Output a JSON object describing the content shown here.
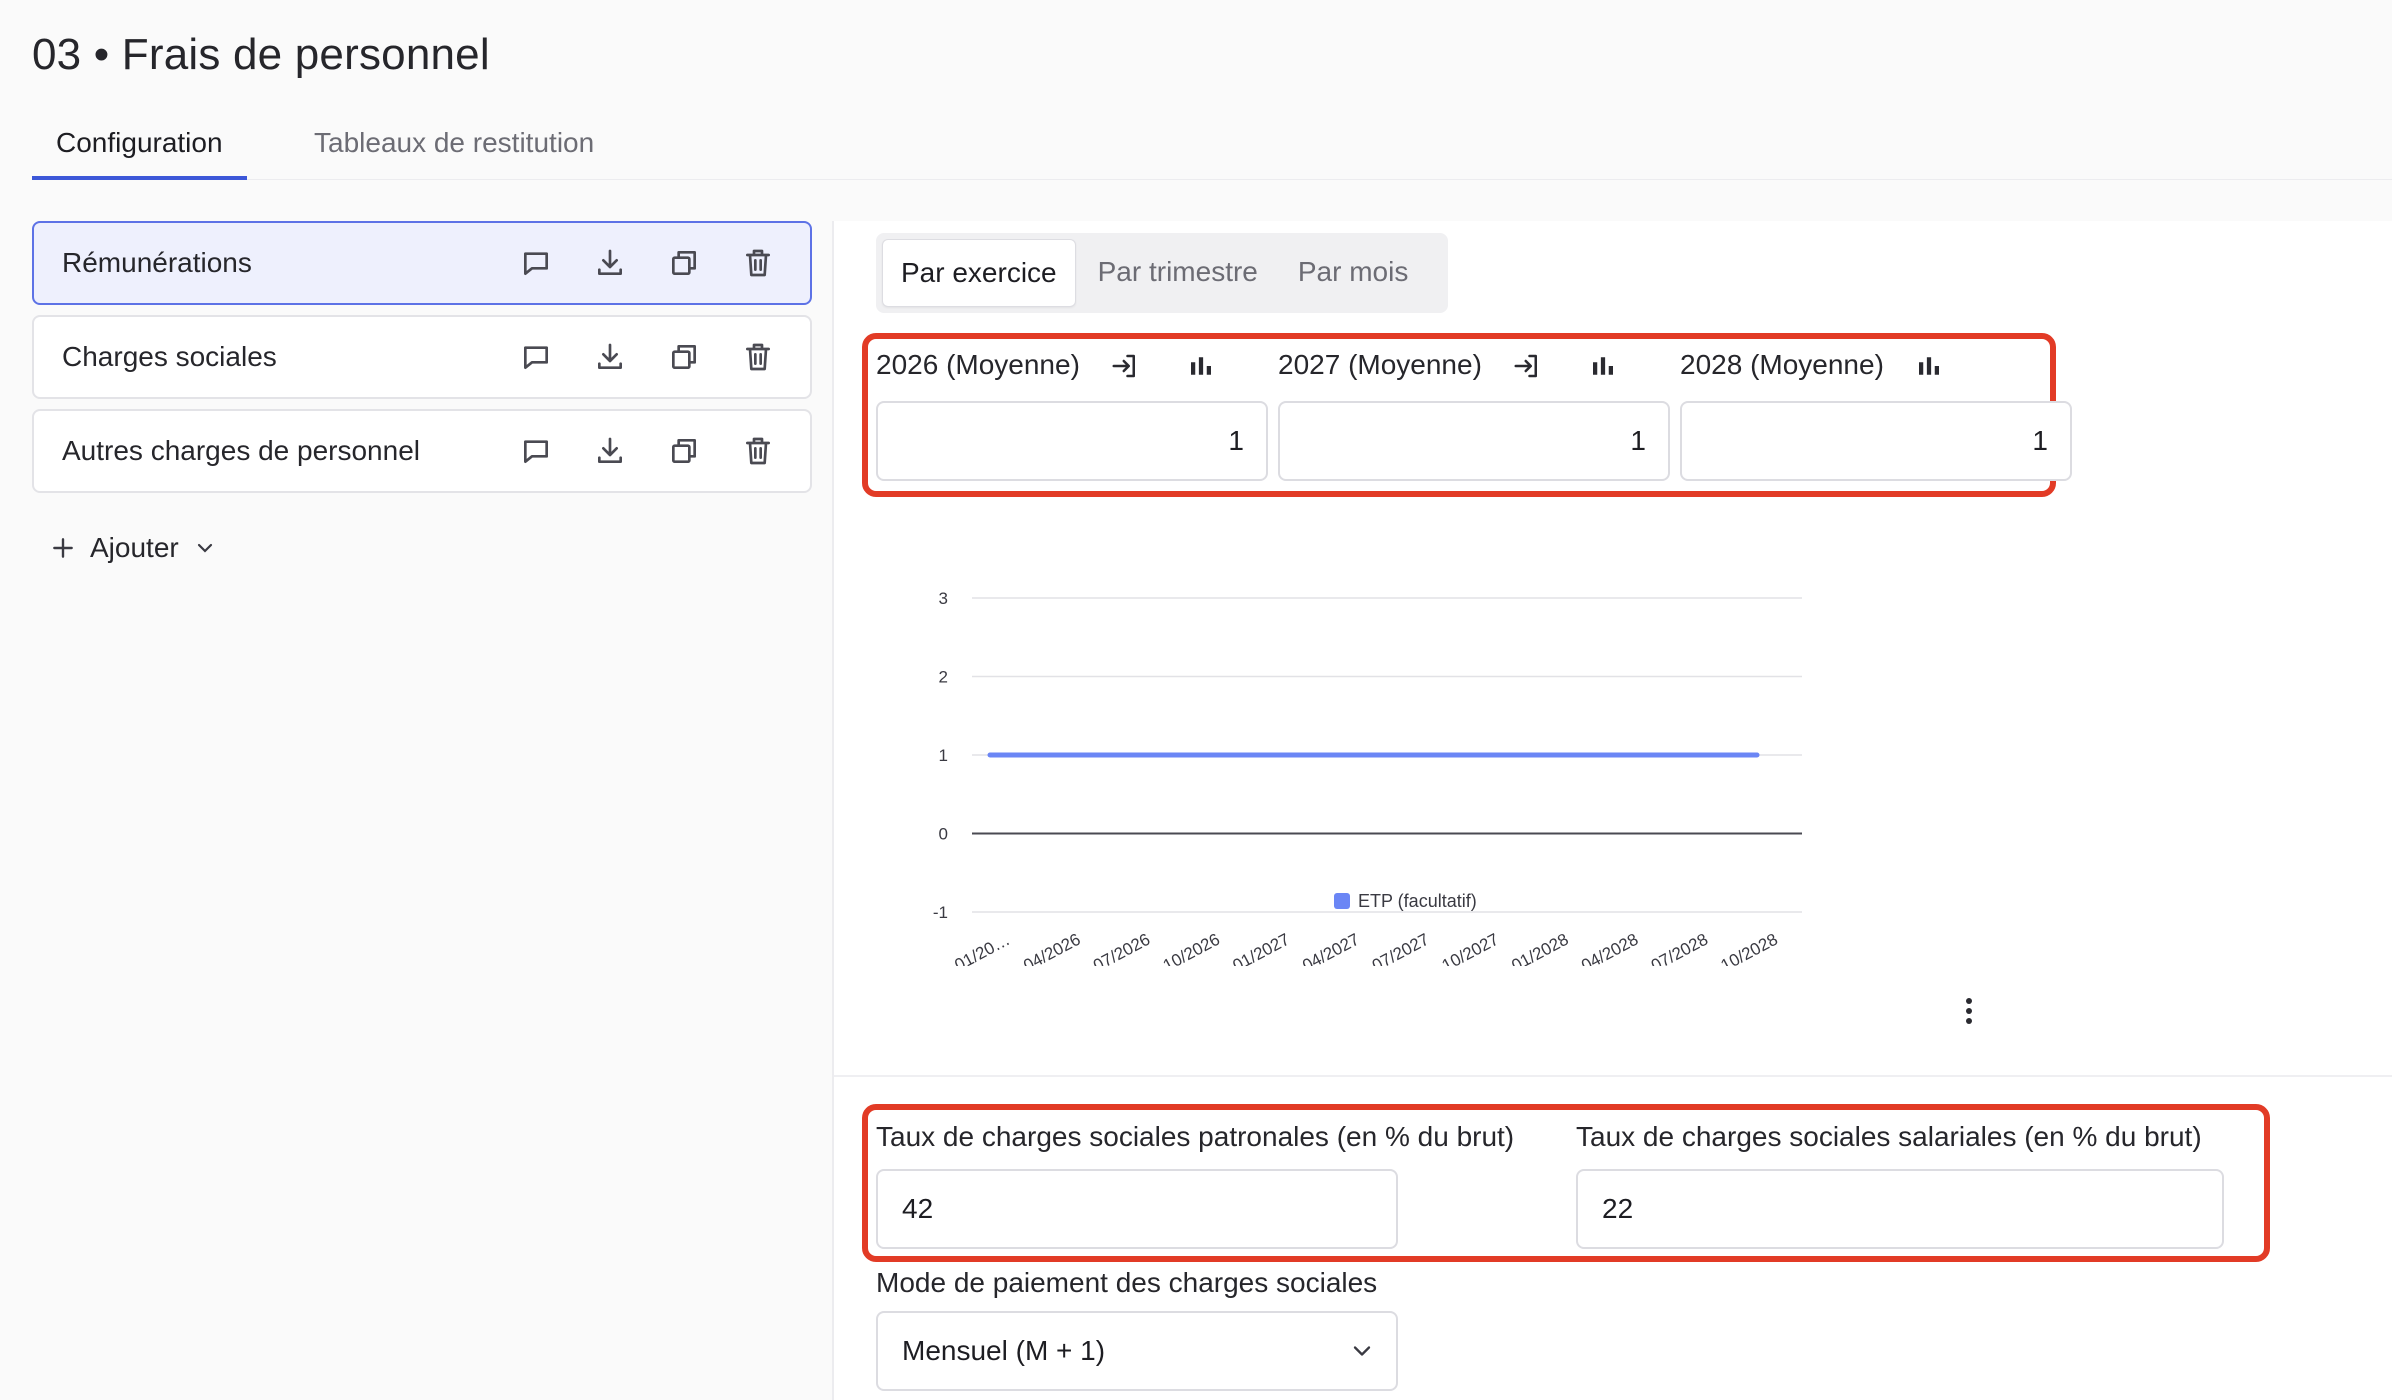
{
  "page": {
    "title": "03 • Frais de personnel"
  },
  "tabs": [
    {
      "label": "Configuration",
      "active": true
    },
    {
      "label": "Tableaux de restitution",
      "active": false
    }
  ],
  "sidebar": {
    "items": [
      {
        "label": "Rémunérations",
        "selected": true
      },
      {
        "label": "Charges sociales",
        "selected": false
      },
      {
        "label": "Autres charges de personnel",
        "selected": false
      }
    ],
    "actions": [
      "comment-icon",
      "download-icon",
      "duplicate-icon",
      "trash-icon"
    ],
    "add_label": "Ajouter"
  },
  "period_selector": {
    "options": [
      "Par exercice",
      "Par trimestre",
      "Par mois"
    ],
    "selected": "Par exercice"
  },
  "years": [
    {
      "label": "2026 (Moyenne)",
      "value": "1"
    },
    {
      "label": "2027 (Moyenne)",
      "value": "1"
    },
    {
      "label": "2028 (Moyenne)",
      "value": "1"
    }
  ],
  "chart_data": {
    "type": "line",
    "x": [
      "01/20…",
      "04/2026",
      "07/2026",
      "10/2026",
      "01/2027",
      "04/2027",
      "07/2027",
      "10/2027",
      "01/2028",
      "04/2028",
      "07/2028",
      "10/2028"
    ],
    "series": [
      {
        "name": "ETP (facultatif)",
        "values": [
          1,
          1,
          1,
          1,
          1,
          1,
          1,
          1,
          1,
          1,
          1,
          1
        ],
        "color": "#6b86f5"
      }
    ],
    "yticks": [
      3,
      2,
      1,
      0,
      -1
    ],
    "ylim": [
      -1,
      3
    ],
    "grid": true,
    "legend": "bottom-center"
  },
  "rates": {
    "patronal": {
      "label": "Taux de charges sociales patronales (en % du brut)",
      "value": "42"
    },
    "salarial": {
      "label": "Taux de charges sociales salariales (en % du brut)",
      "value": "22"
    }
  },
  "payment_mode": {
    "label": "Mode de paiement des charges sociales",
    "value": "Mensuel (M + 1)"
  },
  "colors": {
    "accent": "#3c57d8",
    "highlight": "#e23b26",
    "series": "#6b86f5"
  }
}
